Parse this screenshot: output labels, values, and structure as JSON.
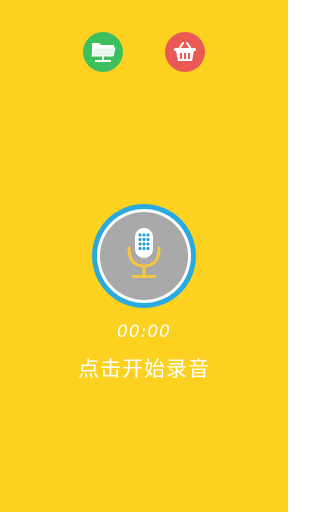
{
  "toolbar": {
    "files_icon": "folder-network-icon",
    "files_color": "#3DBF5E",
    "basket_icon": "basket-icon",
    "basket_color": "#E85A53"
  },
  "recorder": {
    "icon": "microphone-icon",
    "ring_color": "#29ABE2",
    "mic_color": "#F5C842",
    "grille_color": "#2EA3D9",
    "timer": "00:00",
    "hint": "点击开始录音"
  },
  "colors": {
    "background": "#FDD11F"
  }
}
